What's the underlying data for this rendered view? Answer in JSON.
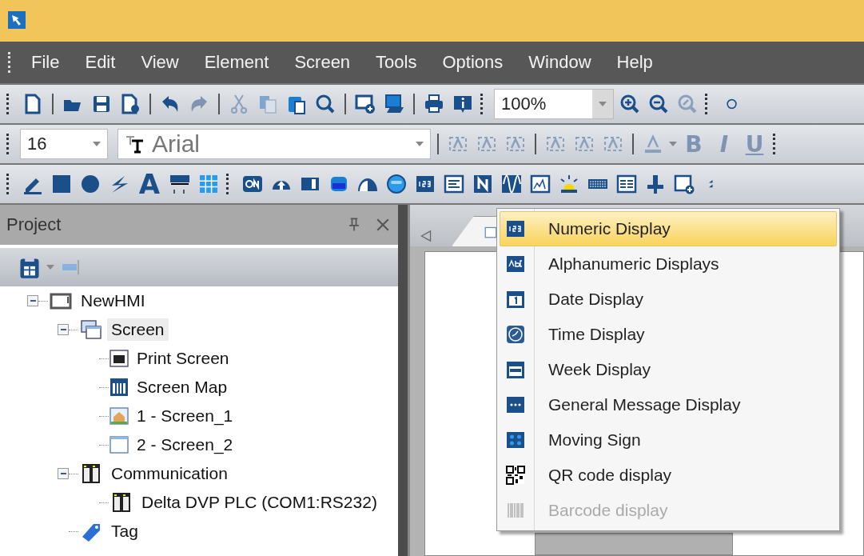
{
  "menu_bar": [
    "File",
    "Edit",
    "View",
    "Element",
    "Screen",
    "Tools",
    "Options",
    "Window",
    "Help"
  ],
  "standard_toolbar": {
    "zoom": "100%"
  },
  "format_toolbar": {
    "font_size": "16",
    "font_name": "Arial",
    "style_buttons": [
      "B",
      "I",
      "U"
    ]
  },
  "drawing_toolbar": {
    "text_tool": "A"
  },
  "project_panel": {
    "title": "Project",
    "tree": [
      {
        "label": "NewHMI",
        "kind": "hmi",
        "expanded": true,
        "selected": false,
        "children": [
          {
            "label": "Screen",
            "kind": "screens",
            "expanded": true,
            "selected": true,
            "children": [
              {
                "label": "Print Screen",
                "kind": "print",
                "selected": false
              },
              {
                "label": "Screen Map",
                "kind": "map",
                "selected": false
              },
              {
                "label": "1 - Screen_1",
                "kind": "home",
                "selected": false
              },
              {
                "label": "2 - Screen_2",
                "kind": "window",
                "selected": false
              }
            ]
          },
          {
            "label": "Communication",
            "kind": "plc",
            "expanded": true,
            "selected": false,
            "children": [
              {
                "label": "Delta DVP PLC (COM1:RS232)",
                "kind": "plc",
                "selected": false
              }
            ]
          },
          {
            "label": "Tag",
            "kind": "tag",
            "selected": false
          }
        ]
      }
    ]
  },
  "popup_menu": [
    {
      "label": "Numeric Display",
      "kind": "numeric",
      "selected": true,
      "disabled": false
    },
    {
      "label": "Alphanumeric Displays",
      "kind": "alpha",
      "selected": false,
      "disabled": false
    },
    {
      "label": "Date Display",
      "kind": "date",
      "selected": false,
      "disabled": false
    },
    {
      "label": "Time Display",
      "kind": "time",
      "selected": false,
      "disabled": false
    },
    {
      "label": "Week Display",
      "kind": "week",
      "selected": false,
      "disabled": false
    },
    {
      "label": "General Message Display",
      "kind": "message",
      "selected": false,
      "disabled": false
    },
    {
      "label": "Moving Sign",
      "kind": "moving",
      "selected": false,
      "disabled": false
    },
    {
      "label": "QR code display",
      "kind": "qr",
      "selected": false,
      "disabled": false
    },
    {
      "label": "Barcode display",
      "kind": "barcode",
      "selected": false,
      "disabled": true
    }
  ]
}
